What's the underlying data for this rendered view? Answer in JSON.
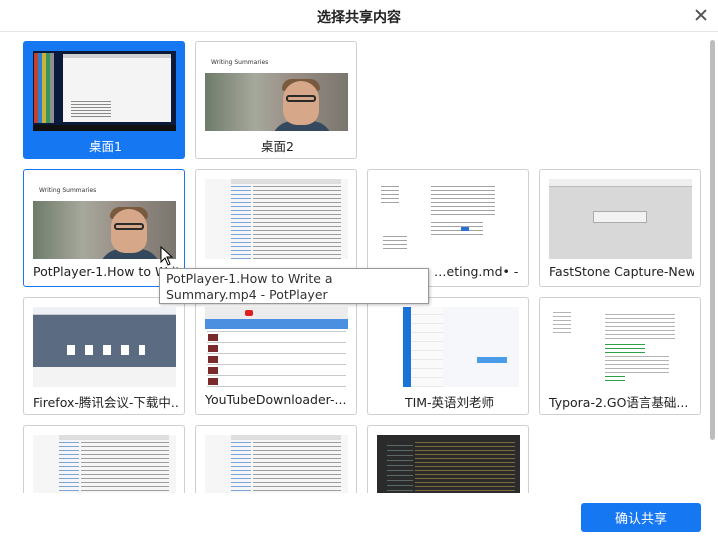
{
  "dialog": {
    "title": "选择共享内容",
    "confirm_label": "确认共享"
  },
  "items": [
    {
      "label": "桌面1",
      "selected": true
    },
    {
      "label": "桌面2",
      "selected": false
    },
    {
      "label": "PotPlayer-1.How to Write a Summary.mp4 - PotPlayer",
      "hovered": true
    },
    {
      "label": ""
    },
    {
      "label": "…eting.md• - Typ…"
    },
    {
      "label": "FastStone Capture-New..."
    },
    {
      "label": "Firefox-腾讯会议-下载中..."
    },
    {
      "label": "YouTubeDownloader-..."
    },
    {
      "label": "TIM-英语刘老师"
    },
    {
      "label": "Typora-2.GO语言基础..."
    },
    {
      "label": ""
    },
    {
      "label": ""
    },
    {
      "label": ""
    }
  ],
  "video_thumb_title": "Writing Summaries",
  "tooltip": "PotPlayer-1.How to Write a Summary.mp4 - PotPlayer",
  "colors": {
    "accent": "#1677f2",
    "card_border": "#cfcfcf"
  }
}
